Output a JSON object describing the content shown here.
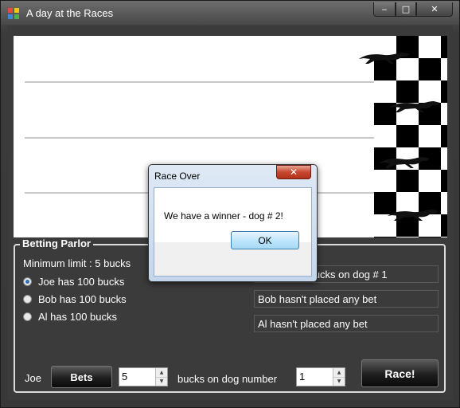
{
  "window": {
    "title": "A day at the Races"
  },
  "titlebar_buttons": {
    "minimize": "‒",
    "maximize": "□",
    "close": "✕"
  },
  "betting_parlor": {
    "legend": "Betting Parlor",
    "minimum_limit": "Minimum limit : 5 bucks",
    "bettors": [
      {
        "label": "Joe has 100 bucks",
        "selected": true
      },
      {
        "label": "Bob has 100 bucks",
        "selected": false
      },
      {
        "label": "Al has 100 bucks",
        "selected": false
      }
    ],
    "bet_status": [
      "Joe bets 5 bucks on dog # 1",
      "Bob hasn't placed any bet",
      "Al hasn't placed any bet"
    ],
    "current_bettor": "Joe",
    "bets_button": "Bets",
    "amount_value": "5",
    "bucks_on_dog_label": "bucks on dog number",
    "dog_number_value": "1",
    "race_button": "Race!"
  },
  "dialog": {
    "title": "Race Over",
    "close": "✕",
    "message": "We have a winner - dog # 2!",
    "ok_button": "OK"
  },
  "colors": {
    "checker": "#000000",
    "dialog_close": "#c7482f",
    "ok_border": "#3c7fb1"
  }
}
